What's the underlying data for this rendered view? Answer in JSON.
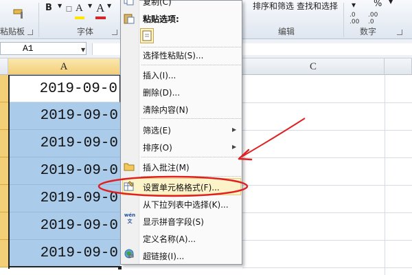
{
  "ribbon": {
    "clipboard_label": "粘贴板",
    "font_label": "字体",
    "editing_label": "编辑",
    "number_label": "数字",
    "sort_filter": "排序和筛选",
    "find_select": "查找和选择",
    "percent": "%",
    "font_color_glyph": "A",
    "fill_glyph": "A",
    "increase_decimal": ".0 .00",
    "decrease_decimal": ".00 .0",
    "accent_red": "#d4272b"
  },
  "formula_bar": {
    "name_box": "A1",
    "formula": ""
  },
  "columns": [
    "A",
    "C"
  ],
  "cells": [
    "2019-09-0",
    "2019-09-0",
    "2019-09-0",
    "2019-09-0",
    "2019-09-0",
    "2019-09-0",
    "2019-09-0"
  ],
  "context_menu": {
    "copy": "复制(C)",
    "paste_options_header": "粘贴选项:",
    "paste_special": "选择性粘贴(S)...",
    "insert": "插入(I)...",
    "delete": "删除(D)...",
    "clear_contents": "清除内容(N)",
    "filter": "筛选(E)",
    "sort": "排序(O)",
    "insert_comment": "插入批注(M)",
    "format_cells": "设置单元格格式(F)...",
    "pick_from_list": "从下拉列表中选择(K)...",
    "phonetic": "显示拼音字段(S)",
    "define_name": "定义名称(A)...",
    "hyperlink": "超链接(I)...",
    "phonetic_icon_text": "wén 文"
  },
  "annotation": {
    "color": "#e02020"
  }
}
